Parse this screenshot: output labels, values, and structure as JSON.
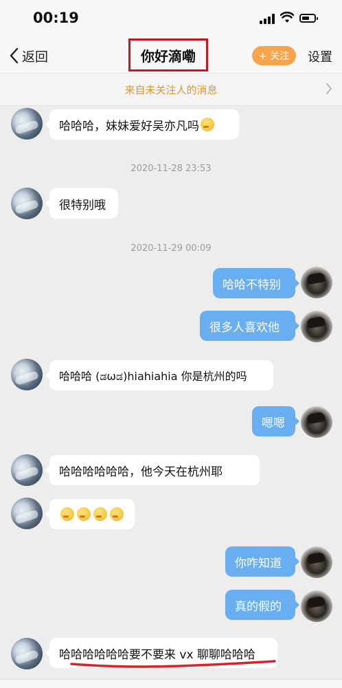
{
  "status_bar": {
    "time": "00:19"
  },
  "nav": {
    "back_label": "返回",
    "title": "你好滴嘞",
    "follow_label": "+ 关注",
    "settings_label": "设置"
  },
  "notice": {
    "text": "来自未关注人的消息"
  },
  "timestamps": [
    "2020-11-28 23:53",
    "2020-11-29 00:09"
  ],
  "messages": [
    {
      "side": "left",
      "text": "哈哈哈，妹妹爱好吴亦凡吗",
      "emoji_count": 1
    },
    {
      "side": "left",
      "text": "很特别哦"
    },
    {
      "side": "right",
      "text": "哈哈不特别"
    },
    {
      "side": "right",
      "text": "很多人喜欢他"
    },
    {
      "side": "left",
      "text": "哈哈哈 (ಡωಡ)hiahiahia 你是杭州的吗"
    },
    {
      "side": "right",
      "text": "嗯嗯"
    },
    {
      "side": "left",
      "text": "哈哈哈哈哈哈，他今天在杭州耶"
    },
    {
      "side": "left",
      "text": "",
      "emoji_count": 4
    },
    {
      "side": "right",
      "text": "你咋知道"
    },
    {
      "side": "right",
      "text": "真的假的"
    },
    {
      "side": "left",
      "text": "哈哈哈哈哈哈要不要来 vx 聊聊哈哈哈"
    }
  ],
  "colors": {
    "accent_follow": "#f7a44c",
    "bubble_right": "#6aaef2",
    "highlight_box": "#c8151b",
    "notice_text": "#d9962e"
  }
}
